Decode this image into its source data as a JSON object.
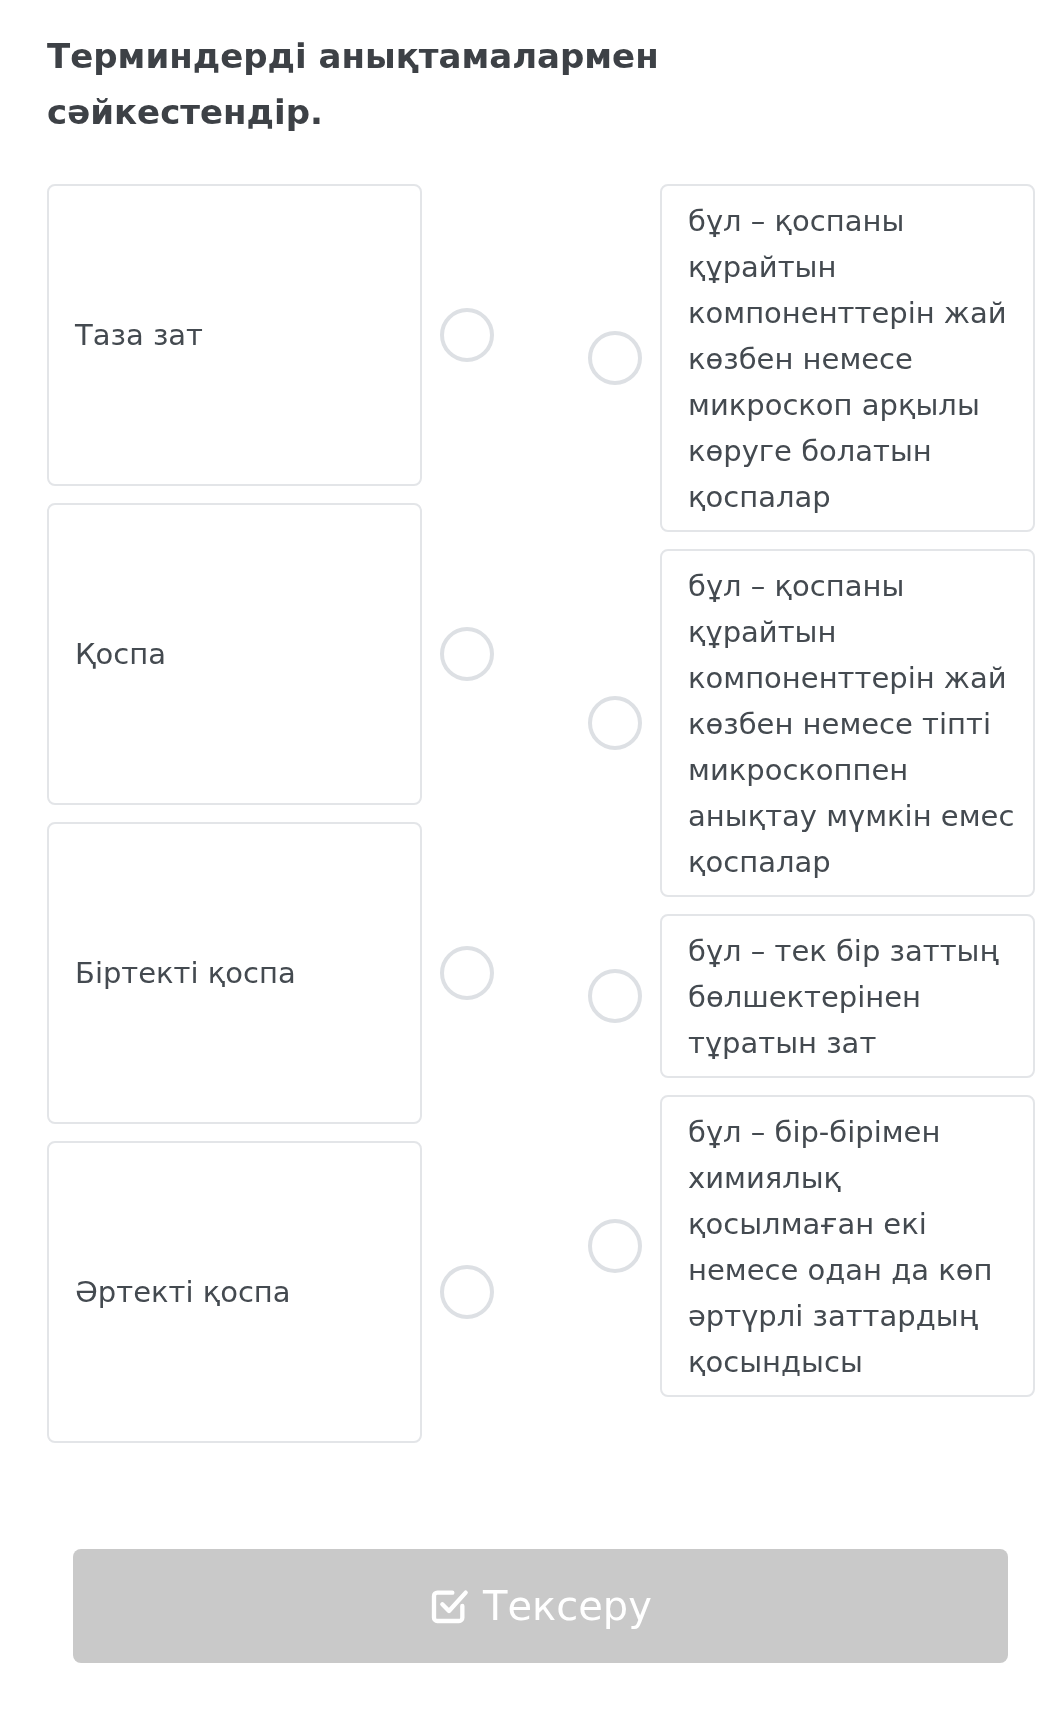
{
  "title": "Терминдерді анықтамалармен сәйкестендір.",
  "terms": [
    {
      "label": "Таза зат",
      "selected": false
    },
    {
      "label": "Қоспа",
      "selected": false
    },
    {
      "label": "Біртекті қоспа",
      "selected": false
    },
    {
      "label": "Әртекті қоспа",
      "selected": false
    }
  ],
  "definitions": [
    {
      "label": "бұл – қоспаны құрайтын компоненттерін жай көзбен немесе микроскоп арқылы көруге болатын қоспалар",
      "selected": false
    },
    {
      "label": "бұл – қоспаны құрайтын компоненттерін жай көзбен немесе тіпті микроскоппен анықтау мүмкін емес қоспалар",
      "selected": false
    },
    {
      "label": "бұл – тек бір заттың бөлшектерінен тұратын зат",
      "selected": false
    },
    {
      "label": "бұл – бір-бірімен химиялық қосылмаған екі немесе одан да көп әртүрлі заттардың қосындысы",
      "selected": false
    }
  ],
  "check_button": {
    "label": "Тексеру",
    "disabled": true
  }
}
